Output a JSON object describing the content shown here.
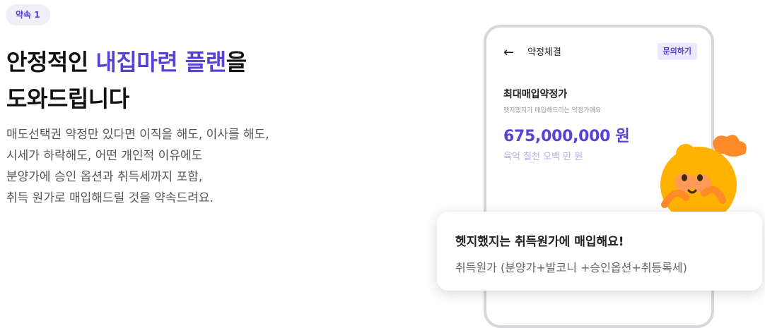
{
  "badge": "약속 1",
  "heading": {
    "part1": "안정적인 ",
    "accent": "내집마련 플랜",
    "part2": "을",
    "line2": "도와드립니다"
  },
  "description": [
    "매도선택권 약정만 있다면 이직을 해도, 이사를 해도,",
    "시세가 하락해도, 어떤 개인적 이유에도",
    "분양가에 승인 옵션과 취득세까지 포함,",
    "취득 원가로 매입해드릴 것을 약속드려요."
  ],
  "phone": {
    "back_icon": "arrow-left-icon",
    "title": "약정체결",
    "inquire_label": "문의하기",
    "price_label": "최대매입약정가",
    "price_sub": "헷지했지가 매입해드리는 약정가에요",
    "price_value": "675,000,000 원",
    "price_korean": "육억 칠천 오백 만 원"
  },
  "card": {
    "title": "헷지했지는 취득원가에 매입해요!",
    "subtitle": "취득원가 (분양가+발코니 +승인옵션+취등록세)"
  },
  "colors": {
    "accent": "#5b3fd9",
    "mascot": "#ffb000"
  }
}
